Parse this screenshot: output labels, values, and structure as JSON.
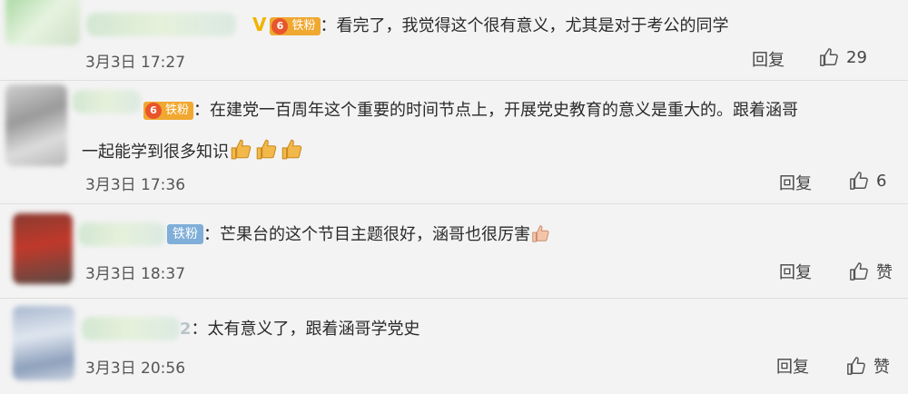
{
  "comments": [
    {
      "text": "看完了，我觉得这个很有意义，尤其是对于考公的同学",
      "badge": "铁粉",
      "badge_level": "6",
      "time": "3月3日 17:27",
      "reply": "回复",
      "likes": "29"
    },
    {
      "text_line1": "在建党一百周年这个重要的时间节点上，开展党史教育的意义是重大的。跟着涵哥",
      "text_line2": "一起能学到很多知识",
      "badge": "铁粉",
      "badge_level": "6",
      "time": "3月3日 17:36",
      "reply": "回复",
      "likes": "6"
    },
    {
      "text": "芒果台的这个节目主题很好，涵哥也很厉害",
      "badge": "铁粉",
      "time": "3月3日 18:37",
      "reply": "回复",
      "likes": "赞"
    },
    {
      "text": "太有意义了，跟着涵哥学党史",
      "level": "2",
      "time": "3月3日 20:56",
      "reply": "回复",
      "likes": "赞"
    }
  ],
  "colors": {
    "background": "#f3f3f3",
    "fan_badge": "#f0a830",
    "iron_badge": "#7faed9",
    "verified": "#f0b400"
  }
}
